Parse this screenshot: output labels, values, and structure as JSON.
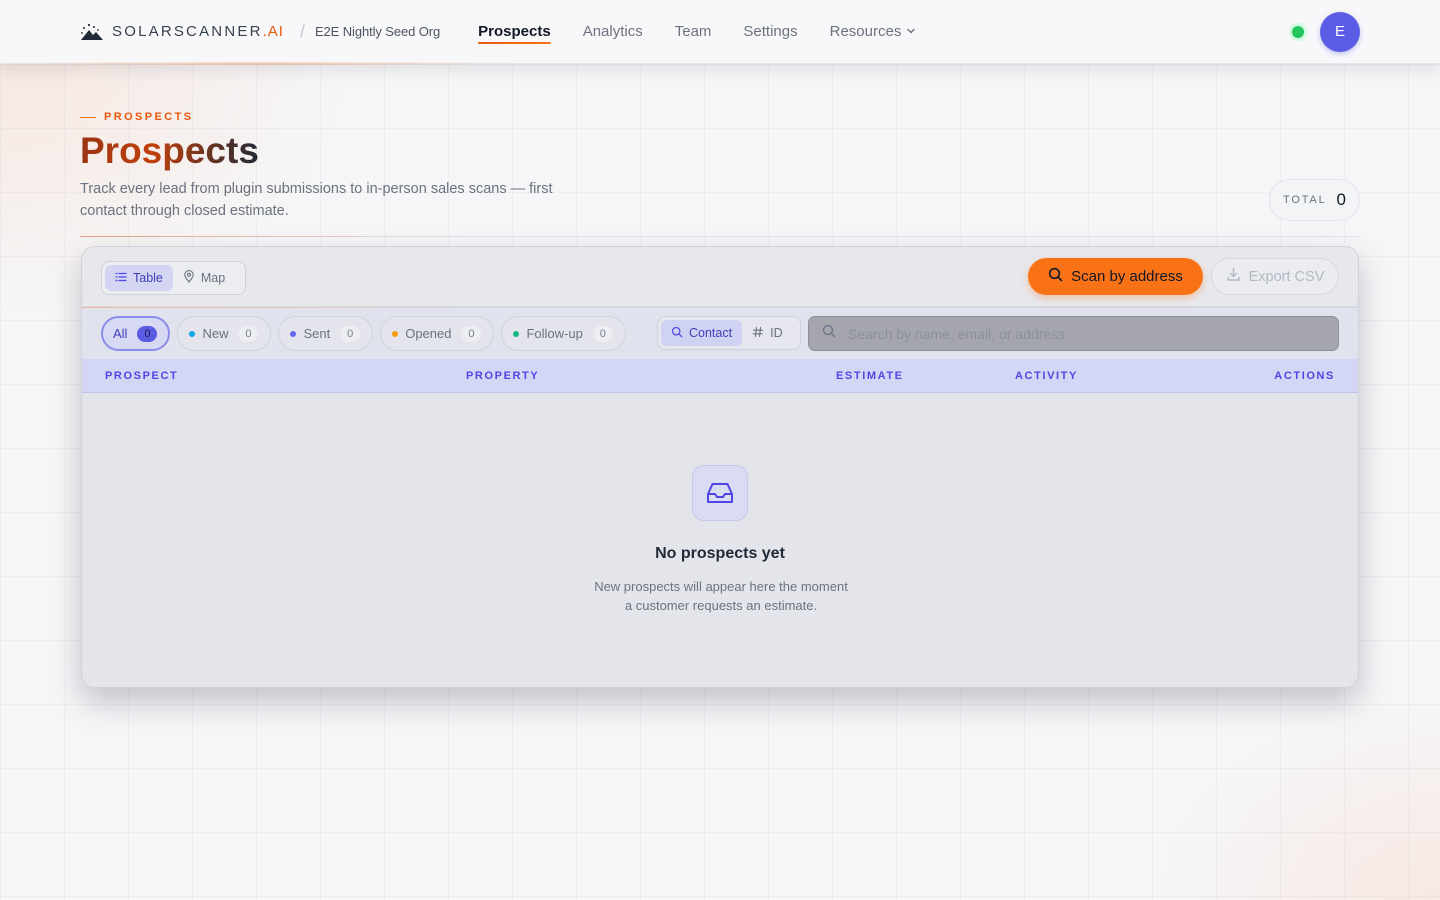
{
  "header": {
    "brand_main": "SOLARSCANNER",
    "brand_suffix": ".AI",
    "separator": "/",
    "org_name": "E2E Nightly Seed Org",
    "nav": [
      {
        "label": "Prospects",
        "active": true
      },
      {
        "label": "Analytics",
        "active": false
      },
      {
        "label": "Team",
        "active": false
      },
      {
        "label": "Settings",
        "active": false
      },
      {
        "label": "Resources",
        "active": false,
        "has_dropdown": true
      }
    ],
    "status_color": "#22c55e",
    "avatar_initial": "E"
  },
  "page": {
    "eyebrow": "PROSPECTS",
    "title": "Prospects",
    "description": "Track every lead from plugin submissions to in-person sales scans — first contact through closed estimate.",
    "total_label": "TOTAL",
    "total_value": "0"
  },
  "toolbar": {
    "view_options": [
      {
        "label": "Table",
        "icon": "list-icon",
        "active": true
      },
      {
        "label": "Map",
        "icon": "map-pin-icon",
        "active": false
      }
    ],
    "scan_button": "Scan by address",
    "export_button": "Export CSV"
  },
  "filters": {
    "chips": [
      {
        "label": "All",
        "count": "0",
        "active": true,
        "dot_color": ""
      },
      {
        "label": "New",
        "count": "0",
        "active": false,
        "dot_color": "#0ea5e9"
      },
      {
        "label": "Sent",
        "count": "0",
        "active": false,
        "dot_color": "#6366f1"
      },
      {
        "label": "Opened",
        "count": "0",
        "active": false,
        "dot_color": "#f59e0b"
      },
      {
        "label": "Follow-up",
        "count": "0",
        "active": false,
        "dot_color": "#10b981"
      }
    ],
    "search_modes": [
      {
        "label": "Contact",
        "icon": "search-icon",
        "active": true
      },
      {
        "label": "ID",
        "icon": "hash-icon",
        "active": false
      }
    ],
    "search_placeholder": "Search by name, email, or address",
    "search_value": ""
  },
  "table": {
    "columns": [
      "PROSPECT",
      "PROPERTY",
      "ESTIMATE",
      "ACTIVITY",
      "ACTIONS"
    ],
    "rows": []
  },
  "empty_state": {
    "icon": "inbox-icon",
    "title": "No prospects yet",
    "description_line1": "New prospects will appear here the moment",
    "description_line2": "a customer requests an estimate."
  },
  "colors": {
    "accent_orange": "#f97316",
    "accent_indigo": "#4f46e5",
    "avatar_bg": "#5b5ce6"
  }
}
